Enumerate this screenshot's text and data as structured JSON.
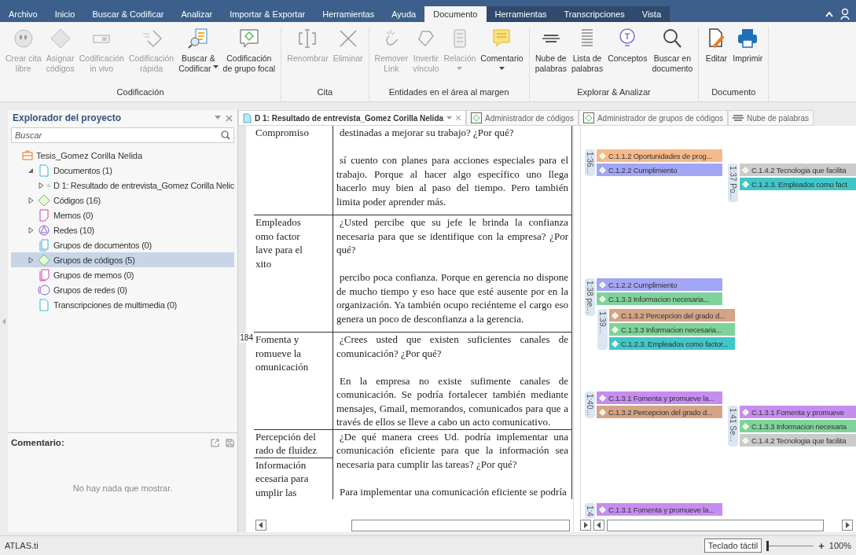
{
  "menu": [
    {
      "label": "Archivo",
      "selected": false,
      "contextual": false
    },
    {
      "label": "Inicio",
      "selected": false,
      "contextual": false
    },
    {
      "label": "Buscar & Codificar",
      "selected": false,
      "contextual": false
    },
    {
      "label": "Analizar",
      "selected": false,
      "contextual": false
    },
    {
      "label": "Importar & Exportar",
      "selected": false,
      "contextual": false
    },
    {
      "label": "Herramientas",
      "selected": false,
      "contextual": false
    },
    {
      "label": "Ayuda",
      "selected": false,
      "contextual": false
    },
    {
      "label": "Documento",
      "selected": true,
      "contextual": true
    },
    {
      "label": "Herramientas",
      "selected": false,
      "contextual": true
    },
    {
      "label": "Transcripciones",
      "selected": false,
      "contextual": true
    },
    {
      "label": "Vista",
      "selected": false,
      "contextual": true
    }
  ],
  "ribbon": [
    {
      "label": "Codificación",
      "buttons": [
        {
          "lines": [
            "Crear cita",
            "libre"
          ],
          "disabled": true
        },
        {
          "lines": [
            "Asignar",
            "códigos"
          ],
          "disabled": true
        },
        {
          "lines": [
            "Codificación",
            "in vivo"
          ],
          "disabled": true
        },
        {
          "lines": [
            "Codificación",
            "rápida"
          ],
          "disabled": true
        },
        {
          "lines": [
            "Buscar &",
            "Codificar"
          ],
          "disabled": false,
          "dropdown": true
        },
        {
          "lines": [
            "Codificación",
            "de grupo focal"
          ],
          "disabled": false
        }
      ]
    },
    {
      "label": "Cita",
      "buttons": [
        {
          "lines": [
            "Renombrar"
          ],
          "disabled": true
        },
        {
          "lines": [
            "Eliminar"
          ],
          "disabled": true
        }
      ]
    },
    {
      "label": "Entidades en el área al margen",
      "buttons": [
        {
          "lines": [
            "Remover",
            "Link"
          ],
          "disabled": true
        },
        {
          "lines": [
            "Invertir",
            "vínculo"
          ],
          "disabled": true
        },
        {
          "lines": [
            "Relación"
          ],
          "disabled": true,
          "dropdown": true
        },
        {
          "lines": [
            "Comentario"
          ],
          "disabled": false,
          "dropdown": true
        }
      ]
    },
    {
      "label": "Explorar & Analizar",
      "buttons": [
        {
          "lines": [
            "Nube de",
            "palabras"
          ],
          "disabled": false
        },
        {
          "lines": [
            "Lista de",
            "palabras"
          ],
          "disabled": false
        },
        {
          "lines": [
            "Conceptos"
          ],
          "disabled": false
        },
        {
          "lines": [
            "Buscar en",
            "documento"
          ],
          "disabled": false
        }
      ]
    },
    {
      "label": "Documento",
      "buttons": [
        {
          "lines": [
            "Editar"
          ],
          "disabled": false
        },
        {
          "lines": [
            "Imprimir"
          ],
          "disabled": false
        }
      ]
    }
  ],
  "explorer": {
    "title": "Explorador del proyecto",
    "search": {
      "placeholder": "Buscar"
    },
    "tree": {
      "label": "Tesis_Gomez Corilla Nelida",
      "children": [
        {
          "label": "Documentos (1)",
          "expanded": true,
          "selected": false,
          "children": [
            {
              "label": "D 1: Resultado de entrevista_Gomez Corilla Nelic",
              "expanded": false,
              "selected": false
            }
          ]
        },
        {
          "label": "Códigos (16)",
          "expanded": false,
          "selected": false
        },
        {
          "label": "Memos (0)",
          "selected": false
        },
        {
          "label": "Redes (10)",
          "expanded": false,
          "selected": false
        },
        {
          "label": "Grupos de documentos (0)",
          "selected": false
        },
        {
          "label": "Grupos de códigos (5)",
          "expanded": false,
          "selected": true
        },
        {
          "label": "Grupos de memos (0)",
          "selected": false
        },
        {
          "label": "Grupos de redes (0)",
          "selected": false
        },
        {
          "label": "Transcripciones de multimedia (0)",
          "selected": false
        }
      ]
    }
  },
  "comment": {
    "title": "Comentario:",
    "empty_text": "No hay nada que mostrar."
  },
  "tabs": [
    {
      "label": "D 1: Resultado de entrevista_Gomez Corilla Nelida",
      "selected": true
    },
    {
      "label": "Administrador de códigos",
      "selected": false
    },
    {
      "label": "Administrador de grupos de códigos",
      "selected": false
    },
    {
      "label": "Nube de palabras",
      "selected": false
    }
  ],
  "document": {
    "rows": [
      {
        "topics": [
          "Compromiso"
        ],
        "paragraphs": [
          "destinadas a mejorar su trabajo? ¿Por qué?",
          "sí cuento con planes para acciones especiales para el trabajo. Porque al hacer algo específico uno llega hacerlo muy bien al paso del tiempo. Pero también limita poder aprender más."
        ]
      },
      {
        "topics": [
          "Empleados\nomo factor\nlave para el\nxito"
        ],
        "paragraphs": [
          "¿Usted percibe que su jefe le brinda la confianza necesaria para que se identifique con la empresa? ¿Por qué?",
          "percibo poca confianza. Porque en gerencia no dispone de mucho tiempo y eso hace que esté ausente por en la organización. Ya también ocupo reciénteme el cargo eso genera un poco de desconfianza a la gerencia."
        ]
      },
      {
        "line_number": "184",
        "topics": [
          "Fomenta y\nromueve la\nomunicación"
        ],
        "paragraphs": [
          "¿Crees usted que existen suficientes canales de comunicación? ¿Por qué?",
          "En la empresa no existe sufimente canales de comunicación. Se podría fortalecer también mediante mensajes, Gmail, memorandos, comunicados para que a través de ellos se lleve a cabo un acto comunicativo."
        ]
      },
      {
        "topics": [
          "Percepción del\nrado de fluidez",
          "Información\necesaria para\numplir las"
        ],
        "paragraphs": [
          "¿De qué manera crees Ud. podría implementar una comunicación eficiente para que la información sea necesaria para cumplir las tareas? ¿Por qué?",
          "Para implementar una comunicación eficiente se podría"
        ]
      }
    ]
  },
  "quotations": [
    {
      "label": "1:36...",
      "codes": [
        {
          "label": "C.1.1.2 Oportunidades de prog...",
          "color": "#f5b98a"
        },
        {
          "label": "C.1.2.2 Cumplimiento",
          "color": "#a3a6f4"
        }
      ]
    },
    {
      "label": "1:37 Po...",
      "codes": [
        {
          "label": "C.1.4.2 Tecnologia que facilita",
          "color": "#cbcbcb"
        },
        {
          "label": "C.1.2.3. Empleados como fact",
          "color": "#41c6c8"
        }
      ]
    },
    {
      "label": "1:38 pe...",
      "codes": [
        {
          "label": "C.1.2.2 Cumplimiento",
          "color": "#a3a6f4"
        },
        {
          "label": "C.1.3.3 Informacion necesaria...",
          "color": "#7fd39a"
        }
      ]
    },
    {
      "label": "1:39...",
      "codes": [
        {
          "label": "C.1.3.2 Percepcion del grado d...",
          "color": "#d3a486"
        },
        {
          "label": "C.1.3.3 Informacion necesaria...",
          "color": "#7fd39a"
        },
        {
          "label": "C.1.2.3. Empleados como factor...",
          "color": "#41c6c8"
        }
      ]
    },
    {
      "label": "1:40...",
      "codes": [
        {
          "label": "C.1.3.1 Fomenta y promueve la...",
          "color": "#c68df0"
        },
        {
          "label": "C.1.3.2 Percepcion del grado d...",
          "color": "#d3a486"
        }
      ]
    },
    {
      "label": "1:41 Se...",
      "codes": [
        {
          "label": "C.1.3.1 Fomenta y promueve",
          "color": "#c68df0"
        },
        {
          "label": "C.1.3.3 Informacion necesaria",
          "color": "#7fd39a"
        },
        {
          "label": "C.1.4.2 Tecnologia que facilita",
          "color": "#cbcbcb"
        }
      ]
    },
    {
      "label": "1:4",
      "codes": [
        {
          "label": "C.1.3.1 Fomenta y promueve la...",
          "color": "#c68df0"
        }
      ]
    }
  ],
  "status": {
    "app": "ATLAS.ti",
    "tooltip": "Teclado táctil",
    "zoom": {
      "level": 0.0,
      "plus": "+",
      "reading": "100%"
    }
  }
}
